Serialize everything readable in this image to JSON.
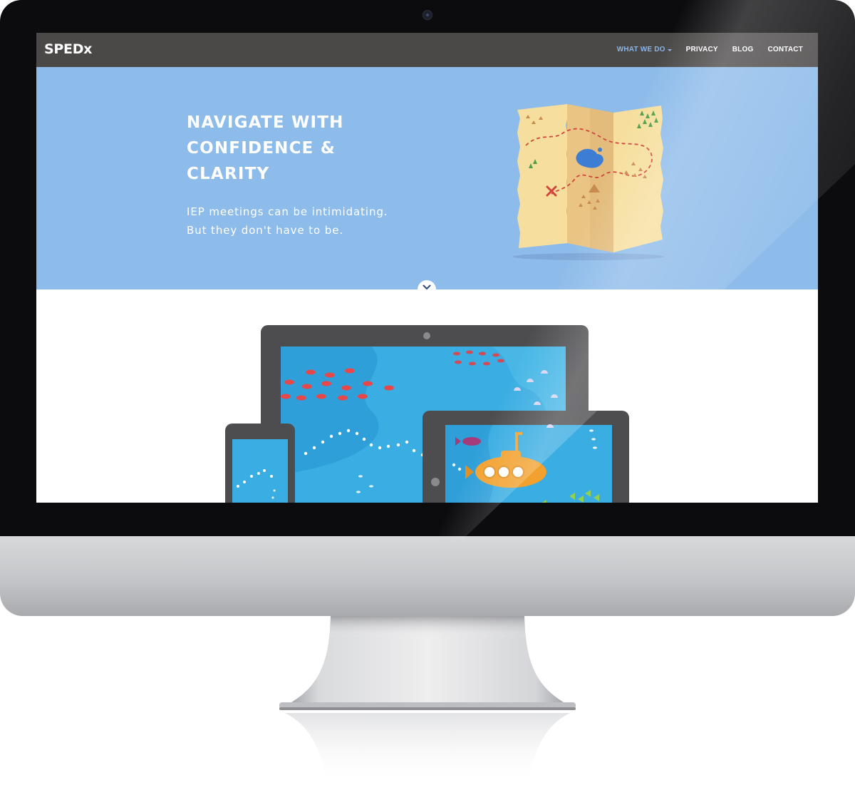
{
  "brand": {
    "logo_text": "SPEDx"
  },
  "nav": {
    "items": [
      {
        "label": "WHAT WE DO",
        "active": true,
        "has_dropdown": true
      },
      {
        "label": "PRIVACY",
        "active": false
      },
      {
        "label": "BLOG",
        "active": false
      },
      {
        "label": "CONTACT",
        "active": false
      }
    ]
  },
  "hero": {
    "title": "NAVIGATE WITH CONFIDENCE & CLARITY",
    "subtitle_line1": "IEP meetings can be intimidating.",
    "subtitle_line2": "But they don't have to be."
  },
  "icons": {
    "scroll": "chevron-down-icon",
    "map": "treasure-map-illustration",
    "devices": "responsive-devices-illustration",
    "submarine": "submarine-icon"
  },
  "colors": {
    "navbar": "#4b4848",
    "nav_active": "#8ab4e6",
    "hero_bg": "#8dbbea",
    "ocean": "#3aade2",
    "device_frame": "#4d4d4f",
    "submarine": "#f2a12e",
    "fish_red": "#e8474a"
  }
}
